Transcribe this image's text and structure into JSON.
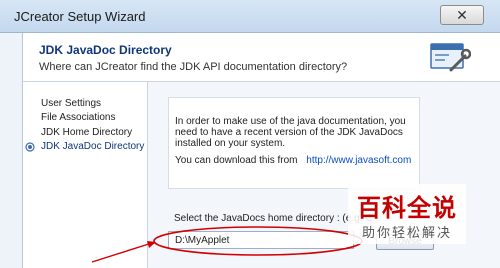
{
  "window": {
    "title": "JCreator Setup Wizard",
    "close_glyph": "✕"
  },
  "header": {
    "title": "JDK JavaDoc Directory",
    "subtitle": "Where can JCreator find the JDK API documentation directory?",
    "icon": "window-wrench-icon"
  },
  "nav": {
    "items": [
      {
        "label": "User Settings",
        "active": false
      },
      {
        "label": "File Associations",
        "active": false
      },
      {
        "label": "JDK Home Directory",
        "active": false
      },
      {
        "label": "JDK JavaDoc Directory",
        "active": true
      }
    ]
  },
  "info": {
    "text": "In order to make use of the java documentation, you need to have a recent version of the JDK JavaDocs installed on your system.",
    "download_text": "You can download this from",
    "download_link": "http://www.javasoft.com"
  },
  "select": {
    "label": "Select the JavaDocs home directory : (e.g. C",
    "path_value": "D:\\MyApplet",
    "browse_label": "Browse"
  },
  "watermark": {
    "main": "百科全说",
    "sub": "助你轻松解决"
  },
  "colors": {
    "annotation_red": "#d40000",
    "link_blue": "#0a4ec8",
    "header_title": "#10357a"
  }
}
